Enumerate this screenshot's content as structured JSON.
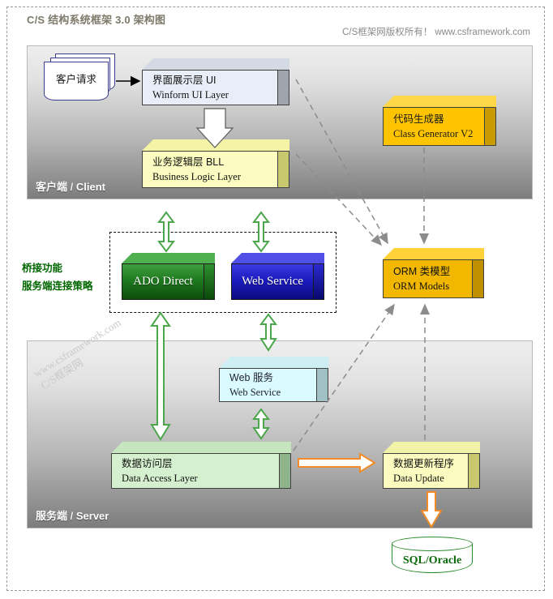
{
  "header": {
    "title": "C/S 结构系统框架 3.0  架构图",
    "copyright": "C/S框架网版权所有！ www.csframework.com"
  },
  "zones": {
    "client": {
      "label_cn": "客户端",
      "sep": " / ",
      "label_en": "Client"
    },
    "server": {
      "label_cn": "服务端",
      "sep": " / ",
      "label_en": "Server"
    }
  },
  "watermark": {
    "line1": "www.csframework.com",
    "line2": "C/S框架网"
  },
  "client_request": {
    "label": "客户请求"
  },
  "boxes": {
    "ui": {
      "title_cn": "界面展示层  UI",
      "title_en": "Winform UI Layer"
    },
    "bll": {
      "title_cn": "业务逻辑层  BLL",
      "title_en": "Business Logic Layer"
    },
    "codegen": {
      "title_cn": "代码生成器",
      "title_en": "Class Generator V2"
    },
    "orm": {
      "title_cn": "ORM 类模型",
      "title_en": "ORM Models"
    },
    "websvc": {
      "title_cn": "Web 服务",
      "title_en": "Web Service"
    },
    "dal": {
      "title_cn": "数据访问层",
      "title_en": "Data Access Layer"
    },
    "dataupdate": {
      "title_cn": "数据更新程序",
      "title_en": "Data Update"
    }
  },
  "bridge": {
    "note_line1": "桥接功能",
    "note_line2": "服务端连接策略",
    "ado": {
      "label": "ADO Direct"
    },
    "webservice": {
      "label": "Web Service"
    }
  },
  "database": {
    "label": "SQL/Oracle"
  },
  "colors": {
    "codegen_gold": "#FFC400",
    "orm_gold": "#F2B800",
    "bll_yellow": "#FCFCC0",
    "ui_blue": "#E8EEF7",
    "dal_green": "#D5F0CF",
    "websvc_cyan": "#D9FBFF",
    "ado_green": "#1F7A1F",
    "ws_blue": "#1C1CC0",
    "green_arrow": "#4CA64C",
    "orange_arrow": "#F28C28",
    "dashed_gray": "#8C8C8C",
    "note_green": "#006600",
    "db_green": "#2D8B2D"
  }
}
